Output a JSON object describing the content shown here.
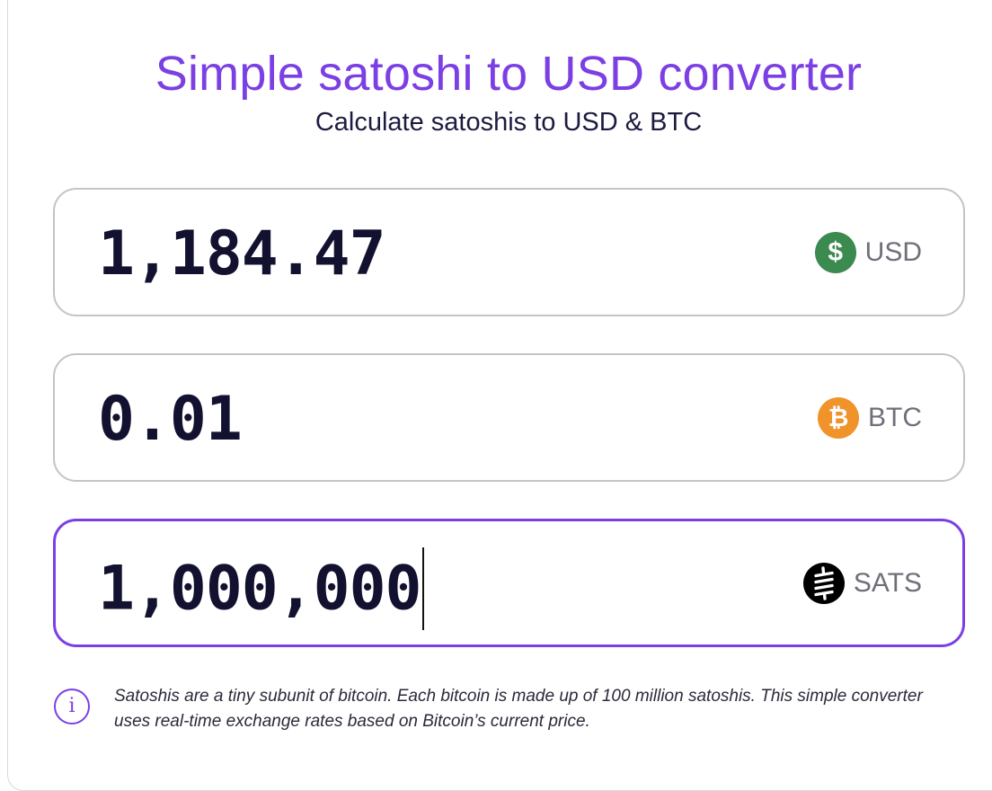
{
  "header": {
    "title": "Simple satoshi to USD converter",
    "subtitle": "Calculate satoshis to USD & BTC"
  },
  "fields": {
    "usd": {
      "value": "1,184.47",
      "unit": "USD",
      "icon": "dollar-coin-icon",
      "symbol": "$",
      "color": "#3b8a4f"
    },
    "btc": {
      "value": "0.01",
      "unit": "BTC",
      "icon": "bitcoin-icon",
      "symbol": "₿",
      "color": "#f0932b"
    },
    "sats": {
      "value": "1,000,000",
      "unit": "SATS",
      "icon": "sats-icon",
      "color": "#000000"
    }
  },
  "info": {
    "icon": "info-icon",
    "glyph": "i",
    "text": "Satoshis are a tiny subunit of bitcoin. Each bitcoin is made up of 100 million satoshis. This simple converter uses real-time exchange rates based on Bitcoin’s current price."
  },
  "colors": {
    "accent": "#7b3fe4",
    "text_dark": "#121230"
  }
}
